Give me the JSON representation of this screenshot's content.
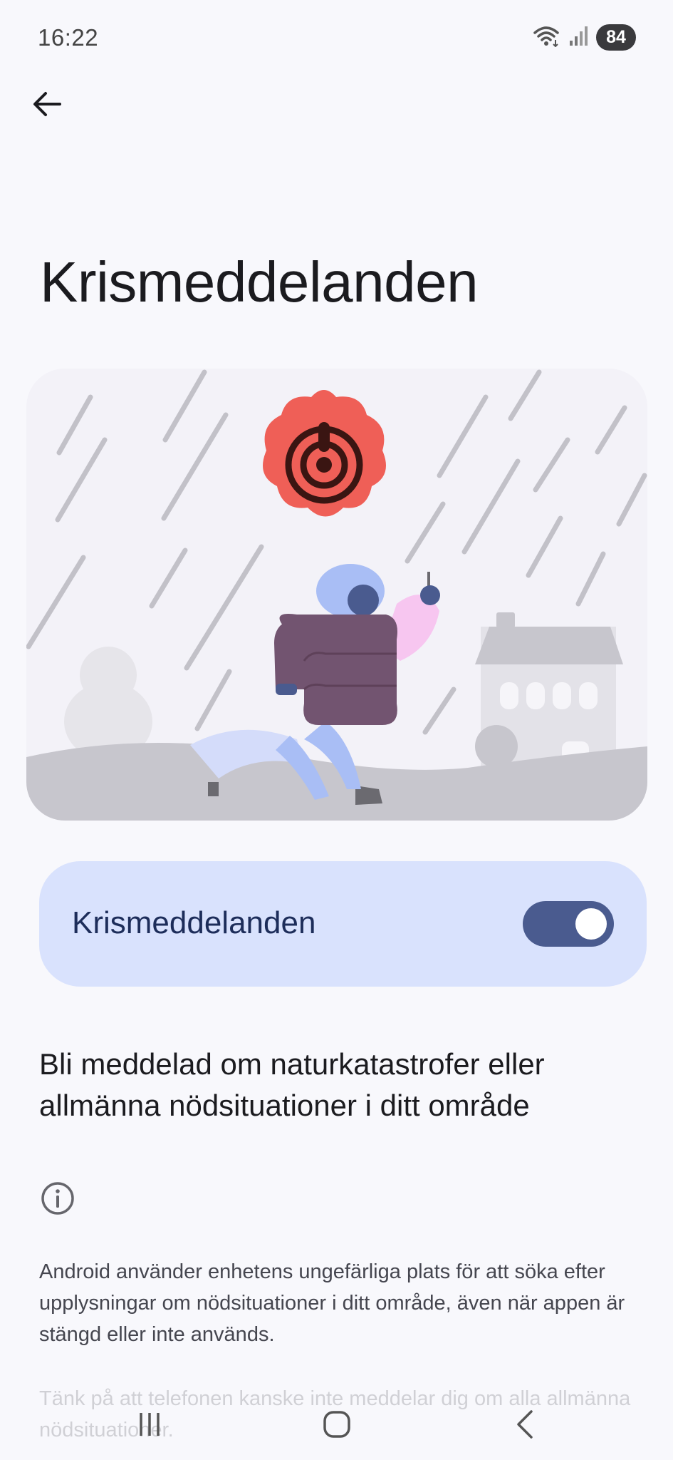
{
  "status_bar": {
    "time": "16:22",
    "battery": "84",
    "icons": [
      "wifi-icon",
      "signal-icon",
      "battery-icon"
    ]
  },
  "header": {
    "back_icon": "arrow-back-icon"
  },
  "page": {
    "title": "Krismeddelanden"
  },
  "illustration": {
    "icon": "emergency-alert-icon",
    "accent_color": "#ef5f57"
  },
  "toggle": {
    "label": "Krismeddelanden",
    "state": "on",
    "track_color": "#4a5b8f",
    "card_color": "#d9e2fd"
  },
  "summary": "Bli meddelad om naturkatastrofer eller allmänna nödsituationer i ditt område",
  "info": {
    "icon": "info-icon",
    "body": "Android använder enhetens ungefärliga plats för att söka efter upplysningar om nödsituationer i ditt område, även när appen är stängd eller inte används.",
    "footnote": "Tänk på att telefonen kanske inte meddelar dig om alla allmänna nödsituationer."
  },
  "nav_bar": {
    "icons": [
      "recents-icon",
      "home-icon",
      "back-icon"
    ]
  }
}
